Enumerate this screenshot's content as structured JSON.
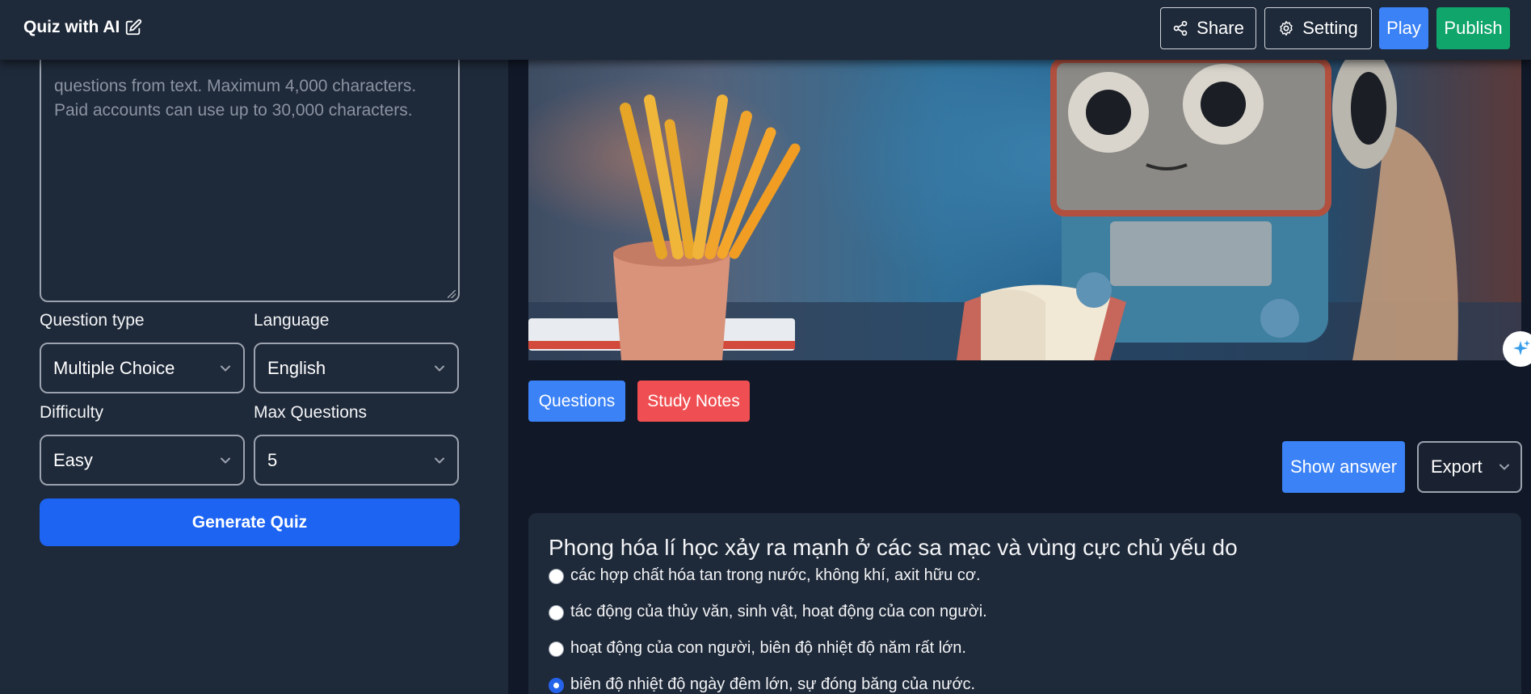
{
  "topbar": {
    "title": "Quiz with AI",
    "share_label": "Share",
    "setting_label": "Setting",
    "play_label": "Play",
    "publish_label": "Publish"
  },
  "sidebar": {
    "textarea_placeholder": "questions from text. Maximum 4,000 characters. Paid accounts can use up to 30,000 characters.",
    "question_type_label": "Question type",
    "question_type_value": "Multiple Choice",
    "language_label": "Language",
    "language_value": "English",
    "difficulty_label": "Difficulty",
    "difficulty_value": "Easy",
    "max_questions_label": "Max Questions",
    "max_questions_value": "5",
    "generate_label": "Generate Quiz"
  },
  "main": {
    "tabs": [
      {
        "label": "Questions",
        "active": true
      },
      {
        "label": "Study Notes",
        "active": false
      }
    ],
    "show_answer_label": "Show answer",
    "export_label": "Export",
    "question": {
      "text": "Phong hóa lí học xảy ra mạnh ở các sa mạc và vùng cực chủ yếu do",
      "options": [
        {
          "text": "các hợp chất hóa tan trong nước, không khí, axit hữu cơ.",
          "selected": false
        },
        {
          "text": "tác động của thủy văn, sinh vật, hoạt động của con người.",
          "selected": false
        },
        {
          "text": "hoạt động của con người, biên độ nhiệt độ năm rất lớn.",
          "selected": false
        },
        {
          "text": "biên độ nhiệt độ ngày đêm lớn, sự đóng băng của nước.",
          "selected": true
        }
      ]
    }
  },
  "colors": {
    "background": "#111827",
    "panel": "#1e2939",
    "primary": "#3b82f6",
    "generate": "#1d64f2",
    "danger": "#ef4f52",
    "publish": "#10a56b"
  }
}
